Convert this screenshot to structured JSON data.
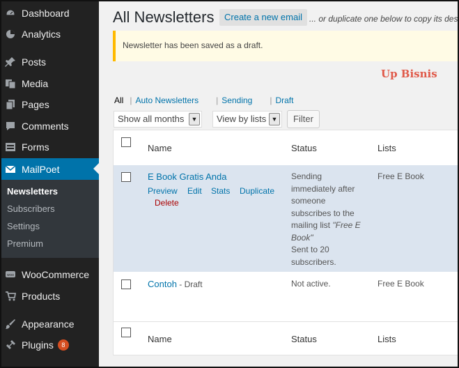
{
  "sidebar": {
    "items": [
      {
        "label": "Dashboard",
        "icon": "dashboard-icon"
      },
      {
        "label": "Analytics",
        "icon": "analytics-icon"
      },
      {
        "label": "Posts",
        "icon": "pin-icon"
      },
      {
        "label": "Media",
        "icon": "media-icon"
      },
      {
        "label": "Pages",
        "icon": "pages-icon"
      },
      {
        "label": "Comments",
        "icon": "comment-icon"
      },
      {
        "label": "Forms",
        "icon": "forms-icon"
      },
      {
        "label": "MailPoet",
        "icon": "mail-icon"
      },
      {
        "label": "WooCommerce",
        "icon": "woocommerce-icon"
      },
      {
        "label": "Products",
        "icon": "cart-icon"
      },
      {
        "label": "Appearance",
        "icon": "brush-icon"
      },
      {
        "label": "Plugins",
        "icon": "plugin-icon",
        "badge": "8"
      }
    ],
    "submenu": [
      "Newsletters",
      "Subscribers",
      "Settings",
      "Premium"
    ],
    "active_color": "#0073aa"
  },
  "header": {
    "title": "All Newsletters",
    "add_new": "Create a new email",
    "duplicate_hint": "... or duplicate one below to copy its desi"
  },
  "notice": {
    "text": "Newsletter has been saved as a draft."
  },
  "watermark": "Up Bisnis",
  "views": {
    "all": "All",
    "auto": "Auto Newsletters",
    "sending": "Sending",
    "draft": "Draft"
  },
  "filters": {
    "months": "Show all months",
    "lists": "View by lists",
    "button": "Filter"
  },
  "table": {
    "columns": {
      "name": "Name",
      "status": "Status",
      "lists": "Lists"
    },
    "rows": [
      {
        "title": "E Book Gratis Anda",
        "actions": {
          "preview": "Preview",
          "edit": "Edit",
          "stats": "Stats",
          "duplicate": "Duplicate",
          "delete": "Delete"
        },
        "status_lines": [
          "Sending",
          "immediately after",
          "someone",
          "subscribes to the"
        ],
        "status_list_pre": "mailing list ",
        "status_list_name": "\"Free E",
        "status_list_name2": "Book\"",
        "status_sent": [
          "Sent to 20",
          "subscribers."
        ],
        "lists": "Free E Book"
      },
      {
        "title": "Contoh",
        "draft": " - Draft",
        "status": "Not active.",
        "lists": "Free E Book"
      }
    ]
  }
}
